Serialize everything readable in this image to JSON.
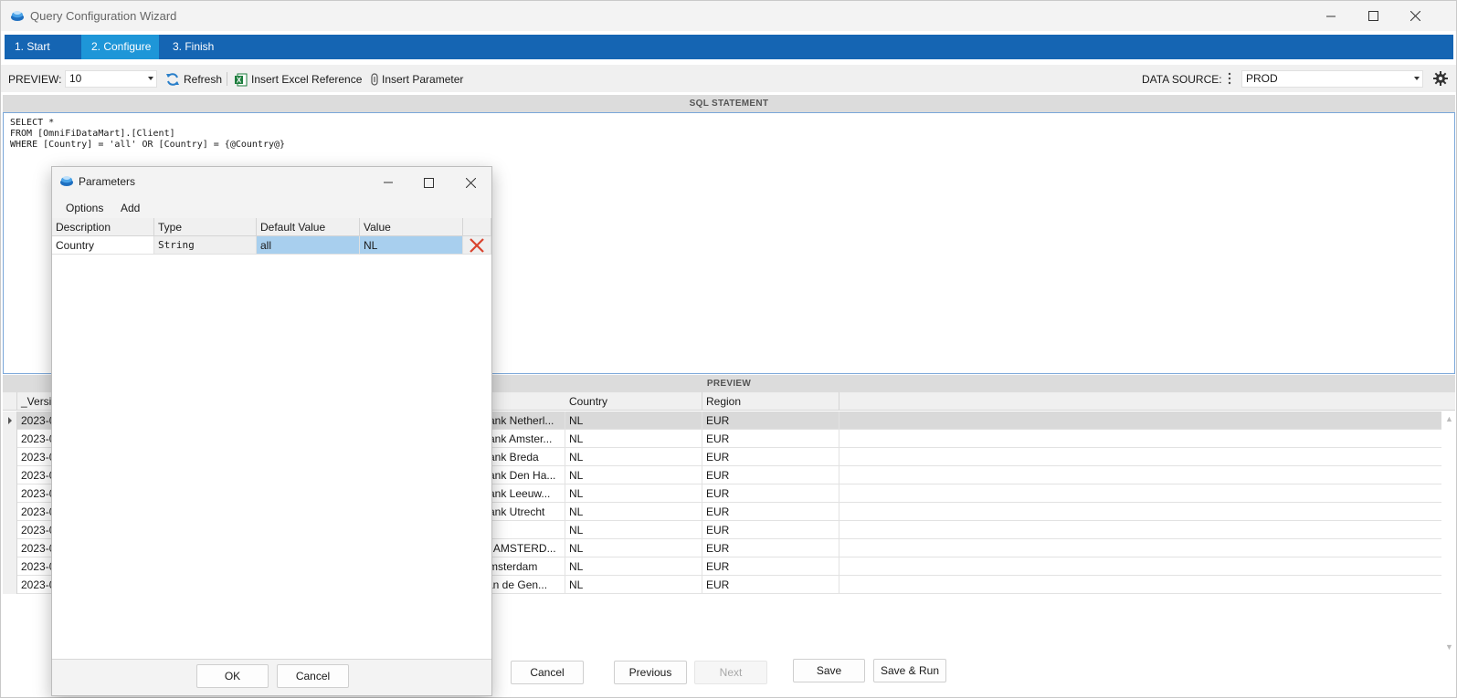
{
  "window": {
    "title": "Query Configuration Wizard"
  },
  "tabs": [
    {
      "label": "1. Start",
      "active": false
    },
    {
      "label": "2. Configure",
      "active": true
    },
    {
      "label": "3. Finish",
      "active": false
    }
  ],
  "toolbar": {
    "preview_label": "PREVIEW:",
    "preview_value": "10",
    "refresh_label": "Refresh",
    "insert_excel_label": "Insert Excel Reference",
    "insert_param_label": "Insert Parameter",
    "data_source_label": "DATA SOURCE:",
    "data_source_value": "PROD"
  },
  "sql": {
    "header": "SQL STATEMENT",
    "lines": [
      "SELECT *",
      "FROM [OmniFiDataMart].[Client]",
      "WHERE [Country] = 'all' OR [Country] = {@Country@}"
    ]
  },
  "preview": {
    "header": "PREVIEW",
    "columns": [
      "_Versi",
      "Country",
      "Region"
    ],
    "rows": [
      {
        "version": "2023-0",
        "name": "Bank Netherl...",
        "country": "NL",
        "region": "EUR"
      },
      {
        "version": "2023-0",
        "name": "Bank Amster...",
        "country": "NL",
        "region": "EUR"
      },
      {
        "version": "2023-0",
        "name": "Bank Breda",
        "country": "NL",
        "region": "EUR"
      },
      {
        "version": "2023-0",
        "name": "Bank Den Ha...",
        "country": "NL",
        "region": "EUR"
      },
      {
        "version": "2023-0",
        "name": "Bank Leeuw...",
        "country": "NL",
        "region": "EUR"
      },
      {
        "version": "2023-0",
        "name": "Bank Utrecht",
        "country": "NL",
        "region": "EUR"
      },
      {
        "version": "2023-0",
        "name": "",
        "country": "NL",
        "region": "EUR"
      },
      {
        "version": "2023-0",
        "name": "V, AMSTERD...",
        "country": "NL",
        "region": "EUR"
      },
      {
        "version": "2023-0",
        "name": "Amsterdam",
        "country": "NL",
        "region": "EUR"
      },
      {
        "version": "2023-0",
        "name": "van de Gen...",
        "country": "NL",
        "region": "EUR"
      }
    ]
  },
  "footer": {
    "cancel_label": "Cancel",
    "previous_label": "Previous",
    "next_label": "Next",
    "save_label": "Save",
    "save_run_label": "Save & Run"
  },
  "parameters_dialog": {
    "title": "Parameters",
    "menu": [
      "Options",
      "Add"
    ],
    "columns": [
      "Description",
      "Type",
      "Default Value",
      "Value"
    ],
    "rows": [
      {
        "description": "Country",
        "type": "String",
        "default_value": "all",
        "value": "NL"
      }
    ],
    "ok_label": "OK",
    "cancel_label": "Cancel"
  },
  "colors": {
    "tab_bar": "#1565b3",
    "tab_active": "#1e96d8",
    "selection": "#a8cfee",
    "delete_icon": "#d9432e",
    "excel_icon": "#1e7e3e"
  }
}
